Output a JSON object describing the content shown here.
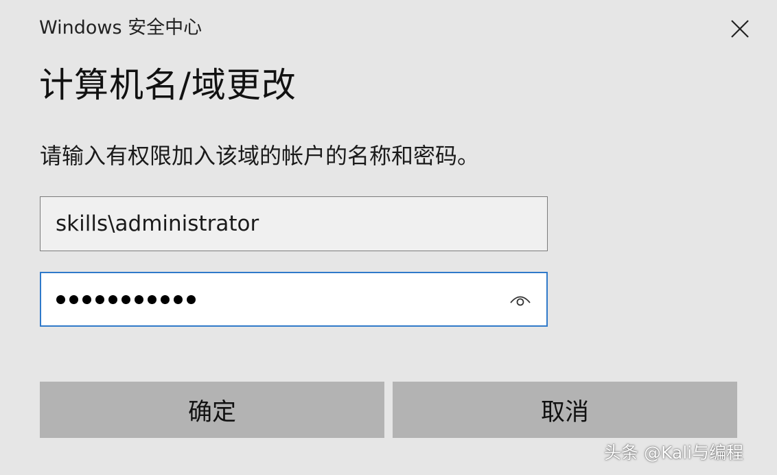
{
  "window": {
    "app_title": "Windows 安全中心",
    "close_icon": "close-icon"
  },
  "dialog": {
    "title": "计算机名/域更改",
    "prompt": "请输入有权限加入该域的帐户的名称和密码。"
  },
  "form": {
    "username_value": "skills\\administrator",
    "password_length": 11,
    "password_reveal_icon": "eye-icon"
  },
  "buttons": {
    "ok_label": "确定",
    "cancel_label": "取消"
  },
  "watermark": {
    "text": "头条 @Kali与编程"
  },
  "colors": {
    "background": "#e6e6e6",
    "focus_border": "#2f79c9",
    "button_bg": "#b3b3b3"
  }
}
